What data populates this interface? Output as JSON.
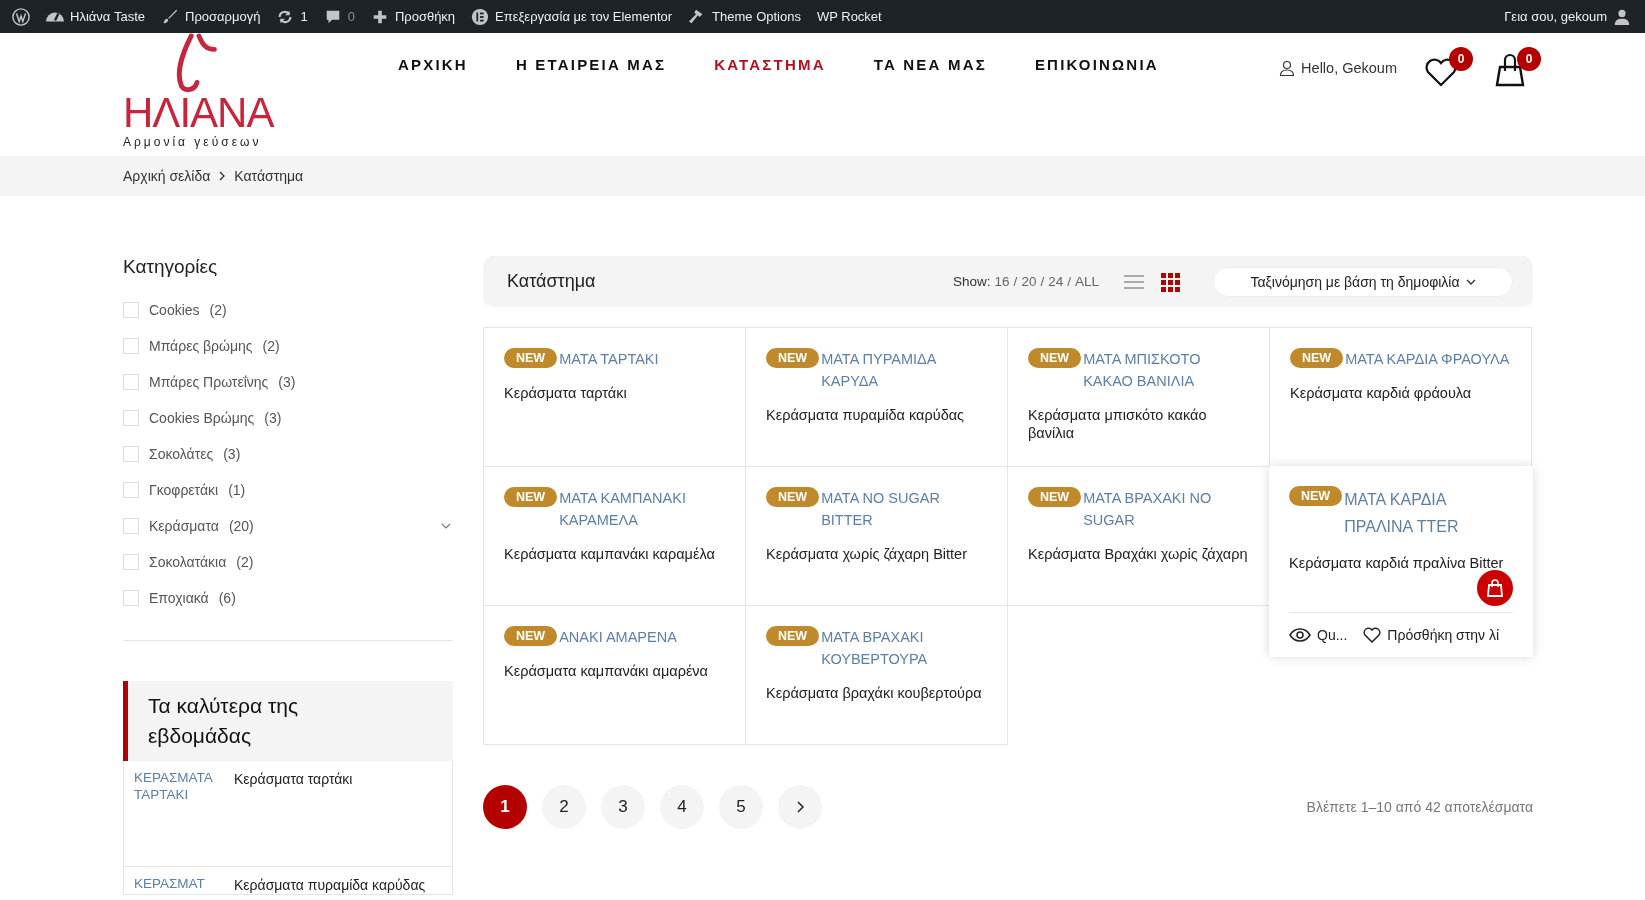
{
  "admin_bar": {
    "items": [
      {
        "kind": "wp"
      },
      {
        "kind": "dashboard",
        "label": "Ηλιάνα Taste"
      },
      {
        "kind": "brush",
        "label": "Προσαρμογή"
      },
      {
        "kind": "updates",
        "label": "1"
      },
      {
        "kind": "comments",
        "label": "0"
      },
      {
        "kind": "plus",
        "label": "Προσθήκη"
      },
      {
        "kind": "elementor",
        "label": "Επεξεργασία με τον Elementor"
      },
      {
        "kind": "hammer",
        "label": "Theme Options"
      },
      {
        "kind": "none",
        "label": "WP Rocket"
      }
    ],
    "greeting": "Γεια σου, gekoum"
  },
  "header": {
    "logo": {
      "name": "ΗΛΙΑΝΑ",
      "tagline": "Αρμονία γεύσεων"
    },
    "nav": [
      {
        "label": "ΑΡΧΙΚΗ",
        "selected": false
      },
      {
        "label": "Η ΕΤΑΙΡΕΙΑ ΜΑΣ",
        "selected": false
      },
      {
        "label": "ΚΑΤΑΣΤΗΜΑ",
        "selected": true
      },
      {
        "label": "ΤΑ ΝΕΑ ΜΑΣ",
        "selected": false
      },
      {
        "label": "ΕΠΙΚΟΙΝΩΝΙΑ",
        "selected": false
      }
    ],
    "account": "Hello, Gekoum",
    "wishlist_count": "0",
    "cart_count": "0"
  },
  "breadcrumb": [
    "Αρχική σελίδα",
    "Κατάστημα"
  ],
  "sidebar": {
    "title": "Κατηγορίες",
    "categories": [
      {
        "name": "Cookies",
        "count": "(2)",
        "checked": false,
        "collapsible": false
      },
      {
        "name": "Μπάρες βρώμης",
        "count": "(2)",
        "checked": false,
        "collapsible": false
      },
      {
        "name": "Μπάρες Πρωτεΐνης",
        "count": "(3)",
        "checked": false,
        "collapsible": false
      },
      {
        "name": "Cookies Βρώμης",
        "count": "(3)",
        "checked": false,
        "collapsible": false
      },
      {
        "name": "Σοκολάτες",
        "count": "(3)",
        "checked": false,
        "collapsible": false
      },
      {
        "name": "Γκοφρετάκι",
        "count": "(1)",
        "checked": false,
        "collapsible": false
      },
      {
        "name": "Κεράσματα",
        "count": "(20)",
        "checked": false,
        "collapsible": true
      },
      {
        "name": "Σοκολατάκια",
        "count": "(2)",
        "checked": false,
        "collapsible": false
      },
      {
        "name": "Εποχιακά",
        "count": "(6)",
        "checked": false,
        "collapsible": false
      }
    ],
    "best_title": "Τα καλύτερα της εβδομάδας",
    "best": [
      {
        "image_alt": "ΚΕΡΑΣΜΑΤΑ ΤΑΡΤΑΚΙ",
        "name": "Κεράσματα ταρτάκι"
      },
      {
        "image_alt": "ΚΕΡΑΣΜΑΤ",
        "name": "Κεράσματα πυραμίδα καρύδας"
      }
    ]
  },
  "shop": {
    "title": "Κατάστημα",
    "show_label": "Show:",
    "show_options": [
      "16",
      "20",
      "24",
      "ALL"
    ],
    "separator": "/",
    "views": [
      {
        "kind": "list",
        "selected": false
      },
      {
        "kind": "grid",
        "selected": true
      }
    ],
    "sort": "Ταξινόμηση με βάση τη δημοφιλία",
    "products": [
      {
        "badge": "NEW",
        "image_alt": "ΜΑΤΑ ΤΑΡΤΑΚΙ",
        "name": "Κεράσματα ταρτάκι",
        "hovered": false
      },
      {
        "badge": "NEW",
        "image_alt": "ΜΑΤΑ ΠΥΡΑΜΙΔΑ ΚΑΡΥΔΑ",
        "name": "Κεράσματα πυραμίδα καρύδας",
        "hovered": false
      },
      {
        "badge": "NEW",
        "image_alt": "ΜΑΤΑ ΜΠΙΣΚΟΤΟ ΚΑΚΑΟ ΒΑΝΙΛΙΑ",
        "name": "Κεράσματα μπισκότο κακάο βανίλια",
        "hovered": false
      },
      {
        "badge": "NEW",
        "image_alt": "ΜΑΤΑ ΚΑΡΔΙΑ ΦΡΑΟΥΛΑ",
        "name": "Κεράσματα καρδιά φράουλα",
        "hovered": false
      },
      {
        "badge": "NEW",
        "image_alt": "ΜΑΤΑ ΚΑΜΠΑΝΑΚΙ ΚΑΡΑΜΕΛΑ",
        "name": "Κεράσματα καμπανάκι καραμέλα",
        "hovered": false
      },
      {
        "badge": "NEW",
        "image_alt": "ΜΑΤΑ NO SUGAR BITTER",
        "name": "Κεράσματα χωρίς ζάχαρη Bitter",
        "hovered": false
      },
      {
        "badge": "NEW",
        "image_alt": "ΜΑΤΑ ΒΡΑΧΑΚΙ NO SUGAR",
        "name": "Κεράσματα Βραχάκι χωρίς ζάχαρη",
        "hovered": false
      },
      {
        "badge": "NEW",
        "image_alt": "ΜΑΤΑ ΚΑΡΔΙΑ ΠΡΑΛΙΝΑ TTER",
        "name": "Κεράσματα καρδιά πραλίνα Bitter",
        "hovered": true,
        "quick_view": "Qu...",
        "wishlist": "Πρόσθήκη στην λί"
      },
      {
        "badge": "NEW",
        "image_alt": "ΑΝΑΚΙ ΑΜΑΡΕΝΑ",
        "name": "Κεράσματα καμπανάκι αμαρένα",
        "hovered": false
      },
      {
        "badge": "NEW",
        "image_alt": "ΜΑΤΑ ΒΡΑΧΑΚΙ ΚΟΥΒΕΡΤΟΥΡΑ",
        "name": "Κεράσματα βραχάκι κουβερτούρα",
        "hovered": false
      }
    ],
    "pages": [
      {
        "label": "1",
        "selected": true
      },
      {
        "label": "2",
        "selected": false
      },
      {
        "label": "3",
        "selected": false
      },
      {
        "label": "4",
        "selected": false
      },
      {
        "label": "5",
        "selected": false
      }
    ],
    "result_count": "Βλέπετε 1–10 από 42 αποτελέσματα"
  }
}
